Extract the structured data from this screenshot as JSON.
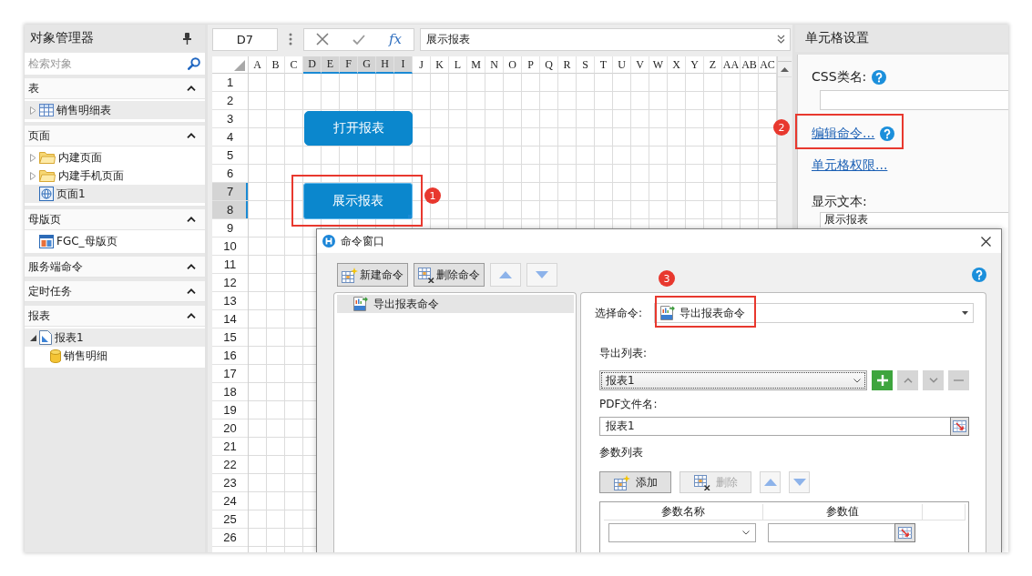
{
  "object_manager": {
    "title": "对象管理器",
    "search": {
      "placeholder": "检索对象"
    },
    "sections": [
      {
        "title": "表",
        "expanded": true,
        "items": [
          {
            "label": "销售明细表",
            "kind": "table",
            "expanded": false,
            "selected": true
          }
        ]
      },
      {
        "title": "页面",
        "expanded": true,
        "items": [
          {
            "label": "内建页面",
            "kind": "folder",
            "expanded": false,
            "selected": false
          },
          {
            "label": "内建手机页面",
            "kind": "folder",
            "expanded": false,
            "selected": false
          },
          {
            "label": "页面1",
            "kind": "page",
            "selected": true
          }
        ]
      },
      {
        "title": "母版页",
        "expanded": true,
        "items": [
          {
            "label": "FGC_母版页",
            "kind": "master",
            "selected": false
          }
        ]
      },
      {
        "title": "服务端命令",
        "expanded": true
      },
      {
        "title": "定时任务",
        "expanded": true
      },
      {
        "title": "报表",
        "expanded": true,
        "items": [
          {
            "label": "报表1",
            "kind": "report",
            "expanded": true,
            "selected": true,
            "children": [
              {
                "label": "销售明细",
                "kind": "data",
                "selected": false
              }
            ]
          }
        ]
      }
    ]
  },
  "formula_bar": {
    "cell": "D7",
    "function_label": "fx",
    "formula": "展示报表"
  },
  "sheet": {
    "columns": [
      {
        "label": "A",
        "selected": false
      },
      {
        "label": "B",
        "selected": false
      },
      {
        "label": "C",
        "selected": false
      },
      {
        "label": "D",
        "selected": true
      },
      {
        "label": "E",
        "selected": true
      },
      {
        "label": "F",
        "selected": true
      },
      {
        "label": "G",
        "selected": true
      },
      {
        "label": "H",
        "selected": true
      },
      {
        "label": "I",
        "selected": true
      },
      {
        "label": "J",
        "selected": false
      },
      {
        "label": "K",
        "selected": false
      },
      {
        "label": "L",
        "selected": false
      },
      {
        "label": "M",
        "selected": false
      },
      {
        "label": "N",
        "selected": false
      },
      {
        "label": "O",
        "selected": false
      },
      {
        "label": "P",
        "selected": false
      },
      {
        "label": "Q",
        "selected": false
      },
      {
        "label": "R",
        "selected": false
      },
      {
        "label": "S",
        "selected": false
      },
      {
        "label": "T",
        "selected": false
      },
      {
        "label": "U",
        "selected": false
      },
      {
        "label": "V",
        "selected": false
      },
      {
        "label": "W",
        "selected": false
      },
      {
        "label": "X",
        "selected": false
      },
      {
        "label": "Y",
        "selected": false
      },
      {
        "label": "Z",
        "selected": false
      },
      {
        "label": "AA",
        "selected": false
      },
      {
        "label": "AB",
        "selected": false
      },
      {
        "label": "AC",
        "selected": false
      }
    ],
    "rows": [
      {
        "label": "1",
        "selected": false
      },
      {
        "label": "2",
        "selected": false
      },
      {
        "label": "3",
        "selected": false
      },
      {
        "label": "4",
        "selected": false
      },
      {
        "label": "5",
        "selected": false
      },
      {
        "label": "6",
        "selected": false
      },
      {
        "label": "7",
        "selected": true
      },
      {
        "label": "8",
        "selected": true
      },
      {
        "label": "9",
        "selected": false
      },
      {
        "label": "10",
        "selected": false
      },
      {
        "label": "11",
        "selected": false
      },
      {
        "label": "12",
        "selected": false
      },
      {
        "label": "13",
        "selected": false
      },
      {
        "label": "14",
        "selected": false
      },
      {
        "label": "15",
        "selected": false
      },
      {
        "label": "16",
        "selected": false
      },
      {
        "label": "17",
        "selected": false
      },
      {
        "label": "18",
        "selected": false
      },
      {
        "label": "19",
        "selected": false
      },
      {
        "label": "20",
        "selected": false
      },
      {
        "label": "21",
        "selected": false
      },
      {
        "label": "22",
        "selected": false
      },
      {
        "label": "23",
        "selected": false
      },
      {
        "label": "24",
        "selected": false
      },
      {
        "label": "25",
        "selected": false
      },
      {
        "label": "26",
        "selected": false
      }
    ],
    "buttons": [
      {
        "label": "打开报表",
        "selected": false
      },
      {
        "label": "展示报表",
        "selected": true
      }
    ]
  },
  "cell_settings": {
    "title": "单元格设置",
    "css_class": {
      "label": "CSS类名:",
      "help": true
    },
    "links": [
      {
        "label": "编辑命令...",
        "help": true
      },
      {
        "label": "单元格权限...",
        "help": false
      }
    ],
    "display_text": {
      "label": "显示文本:",
      "value": "展示报表"
    }
  },
  "command_dialog": {
    "title": "命令窗口",
    "toolbar": [
      {
        "kind": "new",
        "label": "新建命令",
        "disabled": false
      },
      {
        "kind": "delete",
        "label": "删除命令",
        "disabled": false
      },
      {
        "kind": "up",
        "disabled": true
      },
      {
        "kind": "down",
        "disabled": true
      }
    ],
    "commands": [
      {
        "label": "导出报表命令",
        "selected": true
      }
    ],
    "select_command": {
      "label": "选择命令:",
      "value": "导出报表命令"
    },
    "export_list": {
      "label": "导出列表:",
      "value": "报表1",
      "focused": true,
      "tools": [
        {
          "kind": "add",
          "disabled": false
        },
        {
          "kind": "up",
          "disabled": true
        },
        {
          "kind": "down",
          "disabled": true
        },
        {
          "kind": "remove",
          "disabled": true
        }
      ]
    },
    "pdf_file_name": {
      "label": "PDF文件名:",
      "value": "报表1"
    },
    "parameters": {
      "label": "参数列表",
      "toolbar": [
        {
          "kind": "new",
          "label": "添加",
          "disabled": false
        },
        {
          "kind": "delete",
          "label": "删除",
          "disabled": true
        },
        {
          "kind": "up",
          "disabled": true
        },
        {
          "kind": "down",
          "disabled": true
        }
      ],
      "columns": [
        "参数名称",
        "参数值"
      ]
    }
  },
  "annotations": [
    {
      "label": "1"
    },
    {
      "label": "2"
    },
    {
      "label": "3"
    }
  ]
}
